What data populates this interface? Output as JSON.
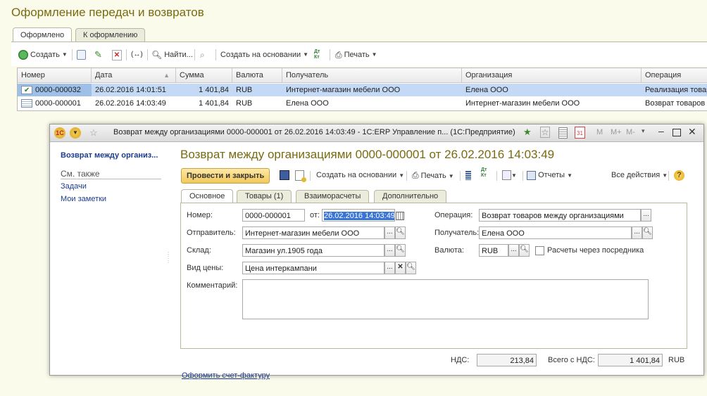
{
  "main": {
    "title": "Оформление передач и возвратов",
    "tabs": [
      {
        "label": "Оформлено"
      },
      {
        "label": "К оформлению"
      }
    ],
    "toolbar": {
      "create": "Создать",
      "find": "Найти...",
      "create_based": "Создать на основании",
      "dtkt": "Дт Кт",
      "print": "Печать"
    },
    "columns": [
      "Номер",
      "Дата",
      "Сумма",
      "Валюта",
      "Получатель",
      "Организация",
      "Операция"
    ],
    "rows": [
      {
        "number": "0000-000032",
        "date": "26.02.2016 14:01:51",
        "sum": "1 401,84",
        "currency": "RUB",
        "recipient": "Интернет-магазин мебели ООО",
        "organization": "Елена ООО",
        "operation": "Реализация товар"
      },
      {
        "number": "0000-000001",
        "date": "26.02.2016 14:03:49",
        "sum": "1 401,84",
        "currency": "RUB",
        "recipient": "Елена ООО",
        "organization": "Интернет-магазин мебели ООО",
        "operation": "Возврат товаров"
      }
    ]
  },
  "dialog": {
    "window_title": "Возврат между организациями 0000-000001 от 26.02.2016 14:03:49 - 1С:ERP Управление п...  (1С:Предприятие)",
    "titlebar_m": [
      "M",
      "M+",
      "M-"
    ],
    "sidebar": {
      "current": "Возврат между организ...",
      "see_also": "См. также",
      "links": [
        "Задачи",
        "Мои заметки"
      ]
    },
    "doc_title": "Возврат между организациями 0000-000001 от 26.02.2016 14:03:49",
    "toolbar": {
      "post_close": "Провести и закрыть",
      "create_based": "Создать на основании",
      "print": "Печать",
      "dtkt": "Дт Кт",
      "reports": "Отчеты",
      "all_actions": "Все действия",
      "help": "?"
    },
    "tabs": [
      {
        "label": "Основное"
      },
      {
        "label": "Товары (1)"
      },
      {
        "label": "Взаиморасчеты"
      },
      {
        "label": "Дополнительно"
      }
    ],
    "form": {
      "number_label": "Номер:",
      "number": "0000-000001",
      "date_label": "от:",
      "date": "26.02.2016 14:03:49",
      "operation_label": "Операция:",
      "operation": "Возврат товаров между организациями",
      "sender_label": "Отправитель:",
      "sender": "Интернет-магазин мебели ООО",
      "recipient_label": "Получатель:",
      "recipient": "Елена ООО",
      "warehouse_label": "Склад:",
      "warehouse": "Магазин ул.1905 года",
      "currency_label": "Валюта:",
      "currency": "RUB",
      "intermediary_label": "Расчеты через посредника",
      "intermediary_checked": false,
      "price_type_label": "Вид цены:",
      "price_type": "Цена интеркампани",
      "comment_label": "Комментарий:",
      "comment": ""
    },
    "totals": {
      "vat_label": "НДС:",
      "vat": "213,84",
      "total_label": "Всего с НДС:",
      "total": "1 401,84",
      "currency": "RUB"
    },
    "invoice_link": "Оформить счет-фактуру"
  }
}
